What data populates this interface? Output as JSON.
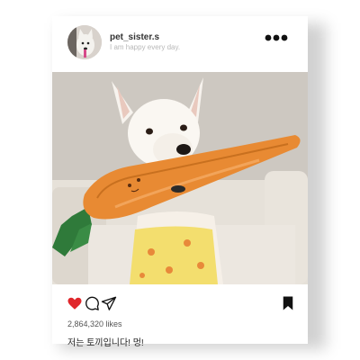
{
  "post": {
    "username": "pet_sister.s",
    "tagline": "I am happy every day.",
    "likes": "2,864,320 likes",
    "caption": "저는 토끼입니다! 멍!"
  },
  "icons": {
    "more": "more-horizontal-icon",
    "like": "heart-icon",
    "comment": "comment-icon",
    "share": "send-icon",
    "save": "bookmark-icon"
  },
  "colors": {
    "like": "#e0262b",
    "icon": "#111111"
  }
}
